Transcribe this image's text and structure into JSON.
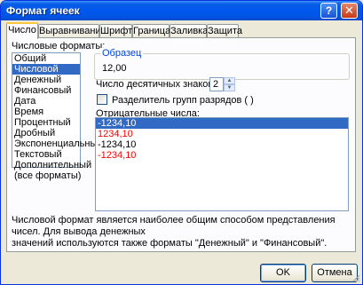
{
  "window": {
    "title": "Формат ячеек"
  },
  "titlebar_buttons": {
    "help": "?",
    "close": "✕"
  },
  "tabs": [
    {
      "label": "Число",
      "active": true
    },
    {
      "label": "Выравнивание"
    },
    {
      "label": "Шрифт"
    },
    {
      "label": "Граница"
    },
    {
      "label": "Заливка"
    },
    {
      "label": "Защита"
    }
  ],
  "formats": {
    "label": "Числовые форматы:",
    "items": [
      "Общий",
      "Числовой",
      "Денежный",
      "Финансовый",
      "Дата",
      "Время",
      "Процентный",
      "Дробный",
      "Экспоненциальный",
      "Текстовый",
      "Дополнительный",
      "(все форматы)"
    ],
    "selected_index": 1
  },
  "sample": {
    "legend": "Образец",
    "value": "12,00"
  },
  "decimals": {
    "label": "Число десятичных знаков:",
    "value": "2"
  },
  "separator": {
    "label": "Разделитель групп разрядов ( )",
    "checked": false
  },
  "negative": {
    "label": "Отрицательные числа:",
    "items": [
      {
        "text": "-1234,10",
        "color": "#000000",
        "selected": true
      },
      {
        "text": "1234,10",
        "color": "#ff0000"
      },
      {
        "text": "-1234,10",
        "color": "#000000"
      },
      {
        "text": "-1234,10",
        "color": "#ff0000"
      }
    ]
  },
  "description": {
    "line1": "Числовой формат является наиболее общим способом представления чисел. Для вывода денежных",
    "line2": "значений используются также форматы \"Денежный\" и \"Финансовый\"."
  },
  "buttons": {
    "ok": "OK",
    "cancel": "Отмена"
  }
}
